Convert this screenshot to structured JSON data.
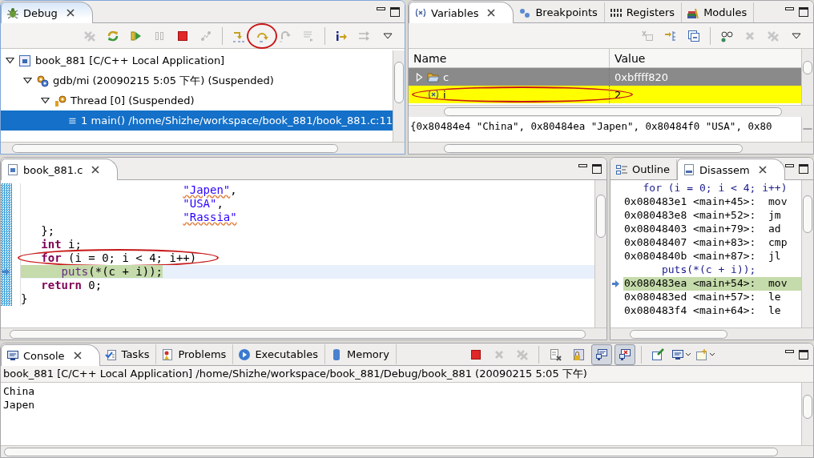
{
  "debug_view": {
    "active": true,
    "tabs": [
      {
        "label": "Debug",
        "kind": "bug",
        "selected": true
      }
    ],
    "toolbar": [
      {
        "kind": "remove-all",
        "enabled": false,
        "circled": false
      },
      {
        "kind": "restart",
        "enabled": true,
        "circled": false
      },
      {
        "kind": "resume",
        "enabled": true,
        "circled": false
      },
      {
        "kind": "suspend",
        "enabled": false,
        "circled": false
      },
      {
        "kind": "terminate",
        "enabled": true,
        "circled": false
      },
      {
        "kind": "disconnect",
        "enabled": false,
        "circled": false
      },
      {
        "kind": "separator"
      },
      {
        "kind": "step-into",
        "enabled": true,
        "circled": false
      },
      {
        "kind": "step-over",
        "enabled": true,
        "circled": true
      },
      {
        "kind": "step-return",
        "enabled": false,
        "circled": false
      },
      {
        "kind": "drop-frame",
        "enabled": false,
        "circled": false
      },
      {
        "kind": "separator"
      },
      {
        "kind": "instruction",
        "enabled": true,
        "circled": false
      },
      {
        "kind": "step-filter",
        "enabled": false,
        "circled": false
      },
      {
        "kind": "view-menu",
        "enabled": true,
        "circled": false
      }
    ],
    "tree": [
      {
        "label": "book_881 [C/C++ Local Application]",
        "kind": "capp",
        "expanded": true,
        "selected": false,
        "children": [
          {
            "label": "gdb/mi (20090215 5:05 下午) (Suspended)",
            "kind": "gears",
            "expanded": true,
            "selected": false,
            "children": [
              {
                "label": "Thread [0] (Suspended)",
                "kind": "thread",
                "expanded": true,
                "selected": false,
                "children": [
                  {
                    "label": "1 main() /home/Shizhe/workspace/book_881/book_881.c:11",
                    "kind": "frame",
                    "selected": true
                  }
                ]
              }
            ]
          }
        ]
      }
    ]
  },
  "variables_view": {
    "active": false,
    "tabs": [
      {
        "label": "Variables",
        "kind": "variable",
        "selected": true
      },
      {
        "label": "Breakpoints",
        "kind": "breakpoint",
        "selected": false
      },
      {
        "label": "Registers",
        "kind": "registers",
        "selected": false
      },
      {
        "label": "Modules",
        "kind": "modules",
        "selected": false
      }
    ],
    "toolbar": [
      {
        "kind": "assign",
        "enabled": false,
        "circled": false
      },
      {
        "kind": "type-names",
        "enabled": true,
        "circled": false
      },
      {
        "kind": "collapse-all",
        "enabled": true,
        "circled": false
      },
      {
        "kind": "separator"
      },
      {
        "kind": "watch",
        "enabled": true,
        "circled": false
      },
      {
        "kind": "remove",
        "enabled": false,
        "circled": false
      },
      {
        "kind": "remove-all",
        "enabled": false,
        "circled": false
      },
      {
        "kind": "view-menu",
        "enabled": true,
        "circled": false
      }
    ],
    "columns": [
      "Name",
      "Value"
    ],
    "rows": [
      {
        "name": "c",
        "kind": "array",
        "value": "0xbffff820",
        "expanded": false,
        "selected": true,
        "changed": false,
        "circled": false
      },
      {
        "name": "i",
        "kind": "scalar",
        "value": "2",
        "selected": false,
        "changed": true,
        "circled": true
      }
    ],
    "detail": "{0x80484e4 \"China\", 0x80484ea \"Japen\", 0x80484f0 \"USA\", 0x80"
  },
  "editor": {
    "active": false,
    "tabs": [
      {
        "label": "book_881.c",
        "kind": "cfile",
        "selected": true
      }
    ],
    "lines": [
      {
        "current": false,
        "circled": false,
        "tokens": [
          {
            "kind": "string",
            "text": "                        \"Japen\"",
            "misspelled": true
          },
          {
            "kind": "plain",
            "text": ","
          }
        ]
      },
      {
        "current": false,
        "circled": false,
        "tokens": [
          {
            "kind": "string",
            "text": "                        \"USA\"",
            "misspelled": false
          },
          {
            "kind": "plain",
            "text": ","
          }
        ]
      },
      {
        "current": false,
        "circled": false,
        "tokens": [
          {
            "kind": "string",
            "text": "                        \"Rassia\"",
            "misspelled": true
          }
        ]
      },
      {
        "current": false,
        "circled": false,
        "tokens": [
          {
            "kind": "plain",
            "text": "   };"
          }
        ]
      },
      {
        "current": false,
        "circled": false,
        "tokens": [
          {
            "kind": "keyword",
            "text": "   int"
          },
          {
            "kind": "plain",
            "text": " i;"
          }
        ]
      },
      {
        "current": false,
        "circled": true,
        "tokens": [
          {
            "kind": "keyword",
            "text": "   for"
          },
          {
            "kind": "plain",
            "text": " (i = 0; i < 4; i++)"
          }
        ]
      },
      {
        "current": true,
        "circled": false,
        "tokens": [
          {
            "kind": "function",
            "text": "      puts"
          },
          {
            "kind": "plain",
            "text": "(*(c + i));"
          }
        ]
      },
      {
        "current": false,
        "circled": false,
        "tokens": [
          {
            "kind": "keyword",
            "text": "   return"
          },
          {
            "kind": "plain",
            "text": " 0;"
          }
        ]
      },
      {
        "current": false,
        "circled": false,
        "tokens": [
          {
            "kind": "plain",
            "text": "}"
          }
        ]
      }
    ]
  },
  "disassembly_view": {
    "active": false,
    "tabs": [
      {
        "label": "Outline",
        "kind": "outline",
        "selected": false
      },
      {
        "label": "Disassem",
        "kind": "disasm",
        "selected": true
      }
    ],
    "lines": [
      {
        "kind": "source",
        "text": "   for (i = 0; i < 4; i++)",
        "current": false
      },
      {
        "kind": "instruction",
        "text": "0x080483e1 <main+45>:  mov",
        "current": false
      },
      {
        "kind": "instruction",
        "text": "0x080483e8 <main+52>:  jm",
        "current": false
      },
      {
        "kind": "instruction",
        "text": "0x08048403 <main+79>:  ad",
        "current": false
      },
      {
        "kind": "instruction",
        "text": "0x08048407 <main+83>:  cmp",
        "current": false
      },
      {
        "kind": "instruction",
        "text": "0x0804840b <main+87>:  jl",
        "current": false
      },
      {
        "kind": "source",
        "text": "      puts(*(c + i));",
        "current": false
      },
      {
        "kind": "instruction",
        "text": "0x080483ea <main+54>:  mov",
        "current": true
      },
      {
        "kind": "instruction",
        "text": "0x080483ed <main+57>:  le",
        "current": false
      },
      {
        "kind": "instruction",
        "text": "0x080483f4 <main+64>:  le",
        "current": false
      }
    ]
  },
  "console_view": {
    "active": false,
    "tabs": [
      {
        "label": "Console",
        "kind": "console",
        "selected": true
      },
      {
        "label": "Tasks",
        "kind": "tasks",
        "selected": false
      },
      {
        "label": "Problems",
        "kind": "problems",
        "selected": false
      },
      {
        "label": "Executables",
        "kind": "executables",
        "selected": false
      },
      {
        "label": "Memory",
        "kind": "memory",
        "selected": false
      }
    ],
    "toolbar": [
      {
        "kind": "terminate",
        "enabled": true,
        "pressed": false
      },
      {
        "kind": "remove",
        "enabled": false,
        "pressed": false
      },
      {
        "kind": "remove-all",
        "enabled": false,
        "pressed": false
      },
      {
        "kind": "separator"
      },
      {
        "kind": "clear",
        "enabled": true,
        "pressed": false
      },
      {
        "kind": "scroll-lock",
        "enabled": true,
        "pressed": false
      },
      {
        "kind": "show-out",
        "enabled": true,
        "pressed": true
      },
      {
        "kind": "show-err",
        "enabled": true,
        "pressed": true
      },
      {
        "kind": "separator"
      },
      {
        "kind": "pin",
        "enabled": true,
        "pressed": false
      },
      {
        "kind": "display",
        "enabled": true,
        "pressed": false,
        "dropdown": true
      },
      {
        "kind": "open-console",
        "enabled": true,
        "pressed": false,
        "dropdown": true
      }
    ],
    "description": "book_881 [C/C++ Local Application] /home/Shizhe/workspace/book_881/Debug/book_881 (20090215 5:05 下午)",
    "output": [
      "China",
      "Japen"
    ]
  }
}
